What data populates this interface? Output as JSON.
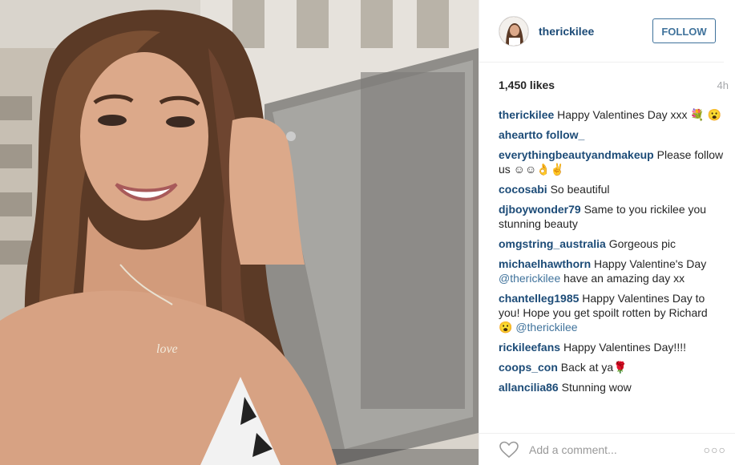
{
  "post": {
    "username": "therickilee",
    "follow_label": "FOLLOW",
    "likes": "1,450 likes",
    "time": "4h"
  },
  "comments": [
    {
      "user": "therickilee",
      "text": " Happy Valentines Day xxx 💐 😮"
    },
    {
      "user": "aheartto follow_",
      "text": ""
    },
    {
      "user": "everythingbeautyandmakeup",
      "text": " Please follow us ☺☺👌✌"
    },
    {
      "user": "cocosabi",
      "text": " So beautiful"
    },
    {
      "user": "djboywonder79",
      "text": " Same to you rickilee you stunning beauty"
    },
    {
      "user": "omgstring_australia",
      "text": " Gorgeous pic"
    },
    {
      "user": "michaelhawthorn",
      "text": " Happy Valentine's Day ",
      "mention": "@therickilee",
      "after": " have an amazing day xx"
    },
    {
      "user": "chantelleg1985",
      "text": " Happy Valentines Day to you! Hope you get spoilt rotten by Richard 😮 ",
      "mention": "@therickilee",
      "after": ""
    },
    {
      "user": "rickileefans",
      "text": " Happy Valentines Day!!!!"
    },
    {
      "user": "coops_con",
      "text": " Back at ya🌹"
    },
    {
      "user": "allancilia86",
      "text": " Stunning wow"
    }
  ],
  "footer": {
    "placeholder": "Add a comment...",
    "more_label": "○○○"
  },
  "icons": {
    "heart": "heart-outline-icon",
    "more": "ellipsis-icon"
  },
  "colors": {
    "username": "#1c4b77",
    "follow": "#3f729b",
    "time": "#a5a7aa"
  }
}
